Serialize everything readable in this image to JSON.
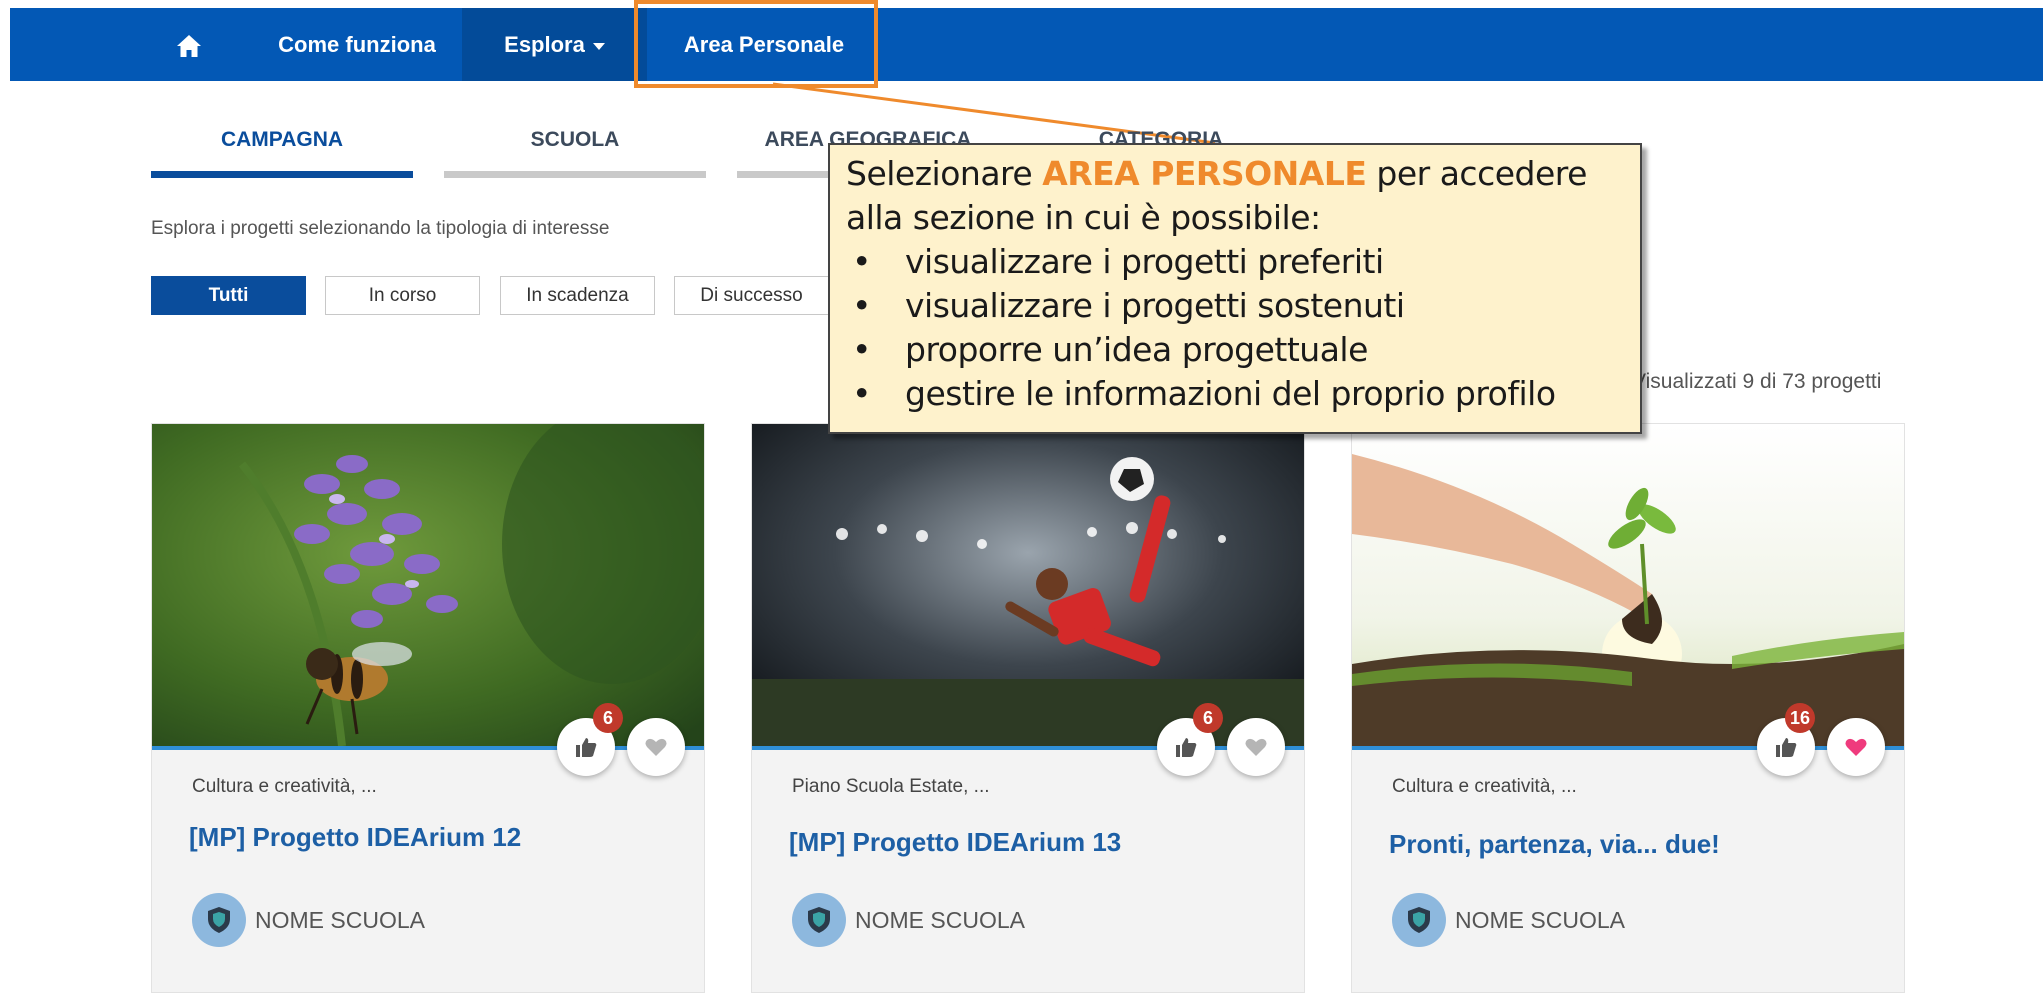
{
  "nav": {
    "home_icon": "home-icon",
    "items": [
      {
        "label": "Come funziona"
      },
      {
        "label": "Esplora"
      },
      {
        "label": "Area Personale"
      }
    ],
    "highlight_color": "#ef8a2c",
    "bar_color": "#0358b5"
  },
  "tabs": [
    {
      "label": "CAMPAGNA",
      "active": true
    },
    {
      "label": "SCUOLA",
      "active": false
    },
    {
      "label": "AREA GEOGRAFICA",
      "active": false
    },
    {
      "label": "CATEGORIA",
      "active": false
    }
  ],
  "explore_text": "Esplora i progetti selezionando la tipologia di interesse",
  "filters": [
    {
      "label": "Tutti",
      "active": true
    },
    {
      "label": "In corso",
      "active": false
    },
    {
      "label": "In scadenza",
      "active": false
    },
    {
      "label": "Di successo",
      "active": false
    }
  ],
  "count_text": "Visualizzati 9 di 73 progetti",
  "cards": [
    {
      "category": "Cultura e creatività, ...",
      "title": "[MP] Progetto IDEArium 12",
      "school": "NOME SCUOLA",
      "likes": "6",
      "image": "flower-bee-image",
      "favorited": false
    },
    {
      "category": "Piano Scuola Estate, ...",
      "title": "[MP] Progetto IDEArium 13",
      "school": "NOME SCUOLA",
      "likes": "6",
      "image": "soccer-player-image",
      "favorited": false
    },
    {
      "category": "Cultura e creatività, ...",
      "title": "Pronti, partenza, via... due!",
      "school": "NOME SCUOLA",
      "likes": "16",
      "image": "hands-plant-image",
      "favorited": true
    }
  ],
  "callout": {
    "intro_pre": "Selezionare ",
    "intro_highlight": "AREA PERSONALE",
    "intro_post": " per accedere alla sezione in cui è possibile:",
    "bullet": "•",
    "bullets": [
      "visualizzare i progetti preferiti",
      "visualizzare i progetti sostenuti",
      "proporre un’idea progettuale",
      "gestire le informazioni del proprio profilo"
    ]
  }
}
